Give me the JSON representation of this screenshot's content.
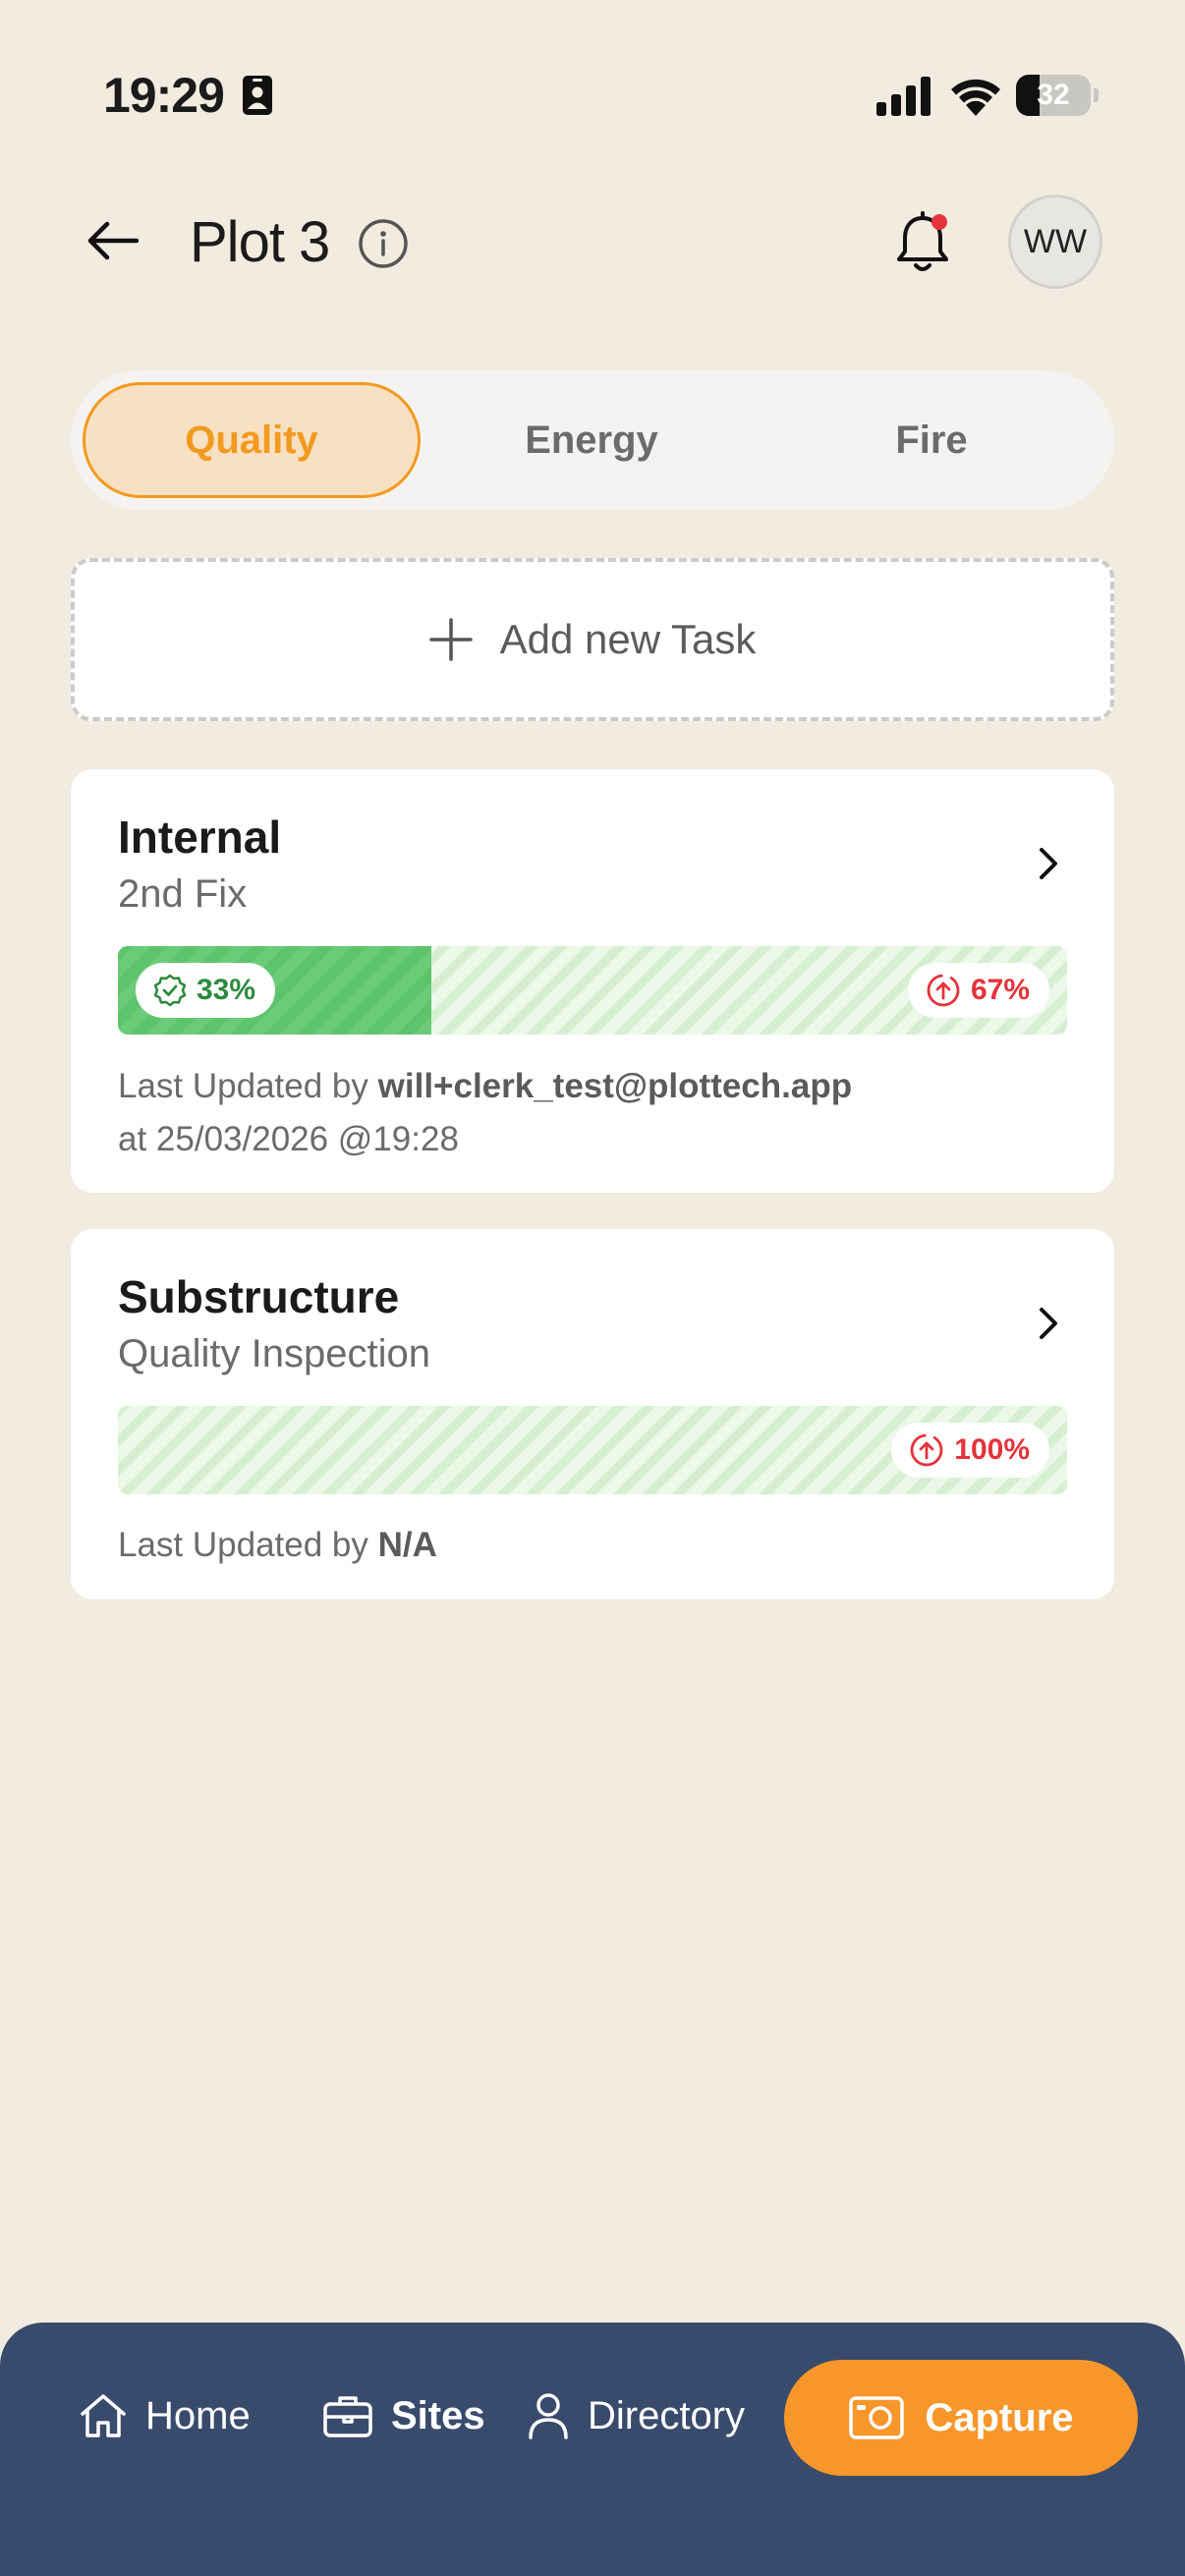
{
  "status_bar": {
    "time": "19:29",
    "battery_level": "32",
    "icons": [
      "id-badge-icon",
      "signal-icon",
      "wifi-icon",
      "battery-icon"
    ]
  },
  "header": {
    "title": "Plot 3",
    "back_icon": "arrow-left-icon",
    "info_icon": "info-icon",
    "bell_icon": "bell-icon",
    "has_notification": true,
    "avatar_initials": "WW"
  },
  "tabs": [
    {
      "label": "Quality",
      "active": true
    },
    {
      "label": "Energy",
      "active": false
    },
    {
      "label": "Fire",
      "active": false
    }
  ],
  "add_task": {
    "label": "Add new Task",
    "icon": "plus-icon"
  },
  "tasks": [
    {
      "title": "Internal",
      "subtitle": "2nd Fix",
      "complete_fraction": 0.33,
      "complete_label": "33%",
      "remaining_label": "67%",
      "updated_prefix": "Last Updated by",
      "updated_by": "will+clerk_test@plottech.app",
      "updated_at": "at 25/03/2026 @19:28"
    },
    {
      "title": "Substructure",
      "subtitle": "Quality Inspection",
      "complete_fraction": 0,
      "remaining_label": "100%",
      "updated_prefix": "Last Updated by",
      "updated_by": "N/A"
    }
  ],
  "bottom_nav": {
    "items": [
      {
        "label": "Home",
        "icon": "home-icon"
      },
      {
        "label": "Sites",
        "icon": "briefcase-icon",
        "active": true
      },
      {
        "label": "Directory",
        "icon": "person-icon"
      }
    ],
    "capture": {
      "label": "Capture",
      "icon": "camera-icon"
    }
  },
  "colors": {
    "accent": "#F29A1F",
    "nav_bg": "#394B6C",
    "capture_bg": "#F7962A",
    "complete_green": "#5EC46C",
    "remaining_red": "#E5333B",
    "page_bg": "#F1EBE0"
  }
}
